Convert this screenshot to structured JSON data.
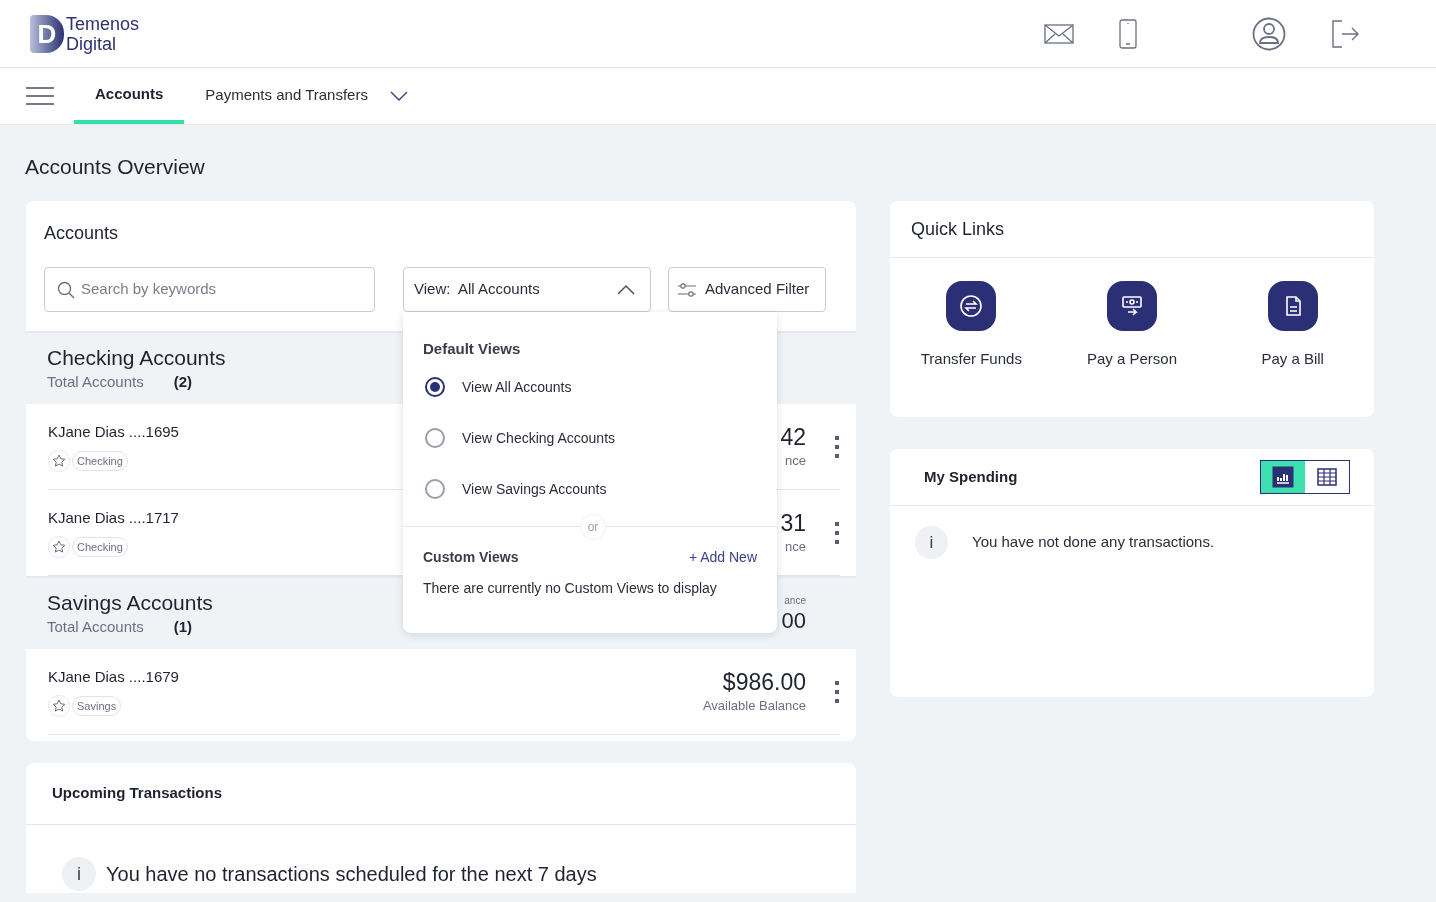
{
  "header": {
    "logo_letter": "D",
    "logo_line1": "Temenos",
    "logo_line2": "Digital"
  },
  "nav": {
    "tabs": [
      {
        "label": "Accounts",
        "selected": true,
        "has_caret": false
      },
      {
        "label": "Payments and Transfers",
        "selected": false,
        "has_caret": true
      }
    ]
  },
  "page_title": "Accounts Overview",
  "accounts": {
    "title": "Accounts",
    "search": {
      "placeholder": "Search by keywords"
    },
    "view_select": {
      "label": "View:",
      "value": "All Accounts",
      "expanded": true
    },
    "advanced_filter": "Advanced Filter",
    "groups": [
      {
        "title": "Checking Accounts",
        "total_label": "Total Accounts",
        "count": "(2)",
        "accounts": [
          {
            "name": "KJane Dias ....1695",
            "tag": "Checking",
            "balance": "42",
            "balance_label": "nce"
          },
          {
            "name": "KJane Dias ....1717",
            "tag": "Checking",
            "balance": "31",
            "balance_label": "nce"
          }
        ]
      },
      {
        "title": "Savings Accounts",
        "total_label": "Total Accounts",
        "count": "(1)",
        "balance": "00",
        "balance_label": "ance",
        "accounts": [
          {
            "name": "KJane Dias ....1679",
            "tag": "Savings",
            "balance": "$986.00",
            "balance_label": "Available Balance"
          }
        ]
      }
    ]
  },
  "view_menu": {
    "default_title": "Default Views",
    "options": [
      {
        "label": "View All Accounts",
        "selected": true
      },
      {
        "label": "View Checking Accounts",
        "selected": false
      },
      {
        "label": "View Savings Accounts",
        "selected": false
      }
    ],
    "divider_text": "or",
    "custom_title": "Custom Views",
    "add_new": "+ Add New",
    "empty_text": "There are currently no Custom Views to display"
  },
  "quick_links": {
    "title": "Quick Links",
    "items": [
      {
        "label": "Transfer Funds",
        "kind": "transfer"
      },
      {
        "label": "Pay a Person",
        "kind": "person"
      },
      {
        "label": "Pay a Bill",
        "kind": "bill"
      }
    ]
  },
  "spending": {
    "title": "My Spending",
    "views": [
      {
        "kind": "chart",
        "selected": true
      },
      {
        "kind": "table",
        "selected": false
      }
    ],
    "info_glyph": "i",
    "message": "You have not done any transactions."
  },
  "upcoming": {
    "title": "Upcoming Transactions",
    "info_glyph": "i",
    "message": "You have no transactions scheduled for the next 7 days"
  }
}
